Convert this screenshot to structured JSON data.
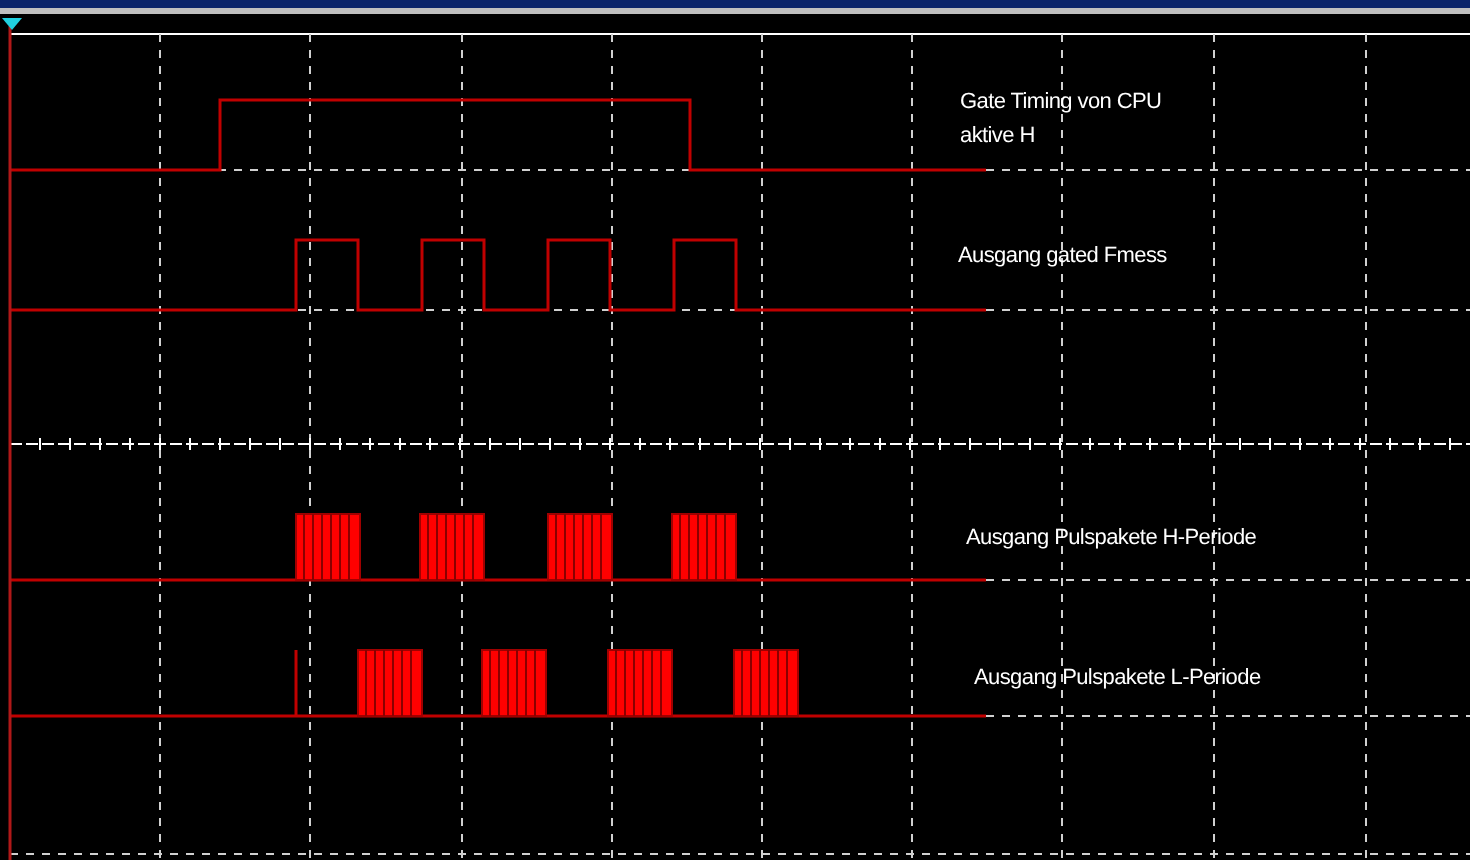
{
  "traces": [
    {
      "kind": "gate",
      "labels": [
        "Gate Timing von CPU",
        "aktive H"
      ]
    },
    {
      "kind": "pulse",
      "labels": [
        "Ausgang gated Fmess"
      ]
    },
    {
      "kind": "burst_h",
      "labels": [
        "Ausgang Pulspakete H-Periode"
      ]
    },
    {
      "kind": "burst_l",
      "labels": [
        "Ausgang Pulspakete L-Periode"
      ]
    }
  ]
}
